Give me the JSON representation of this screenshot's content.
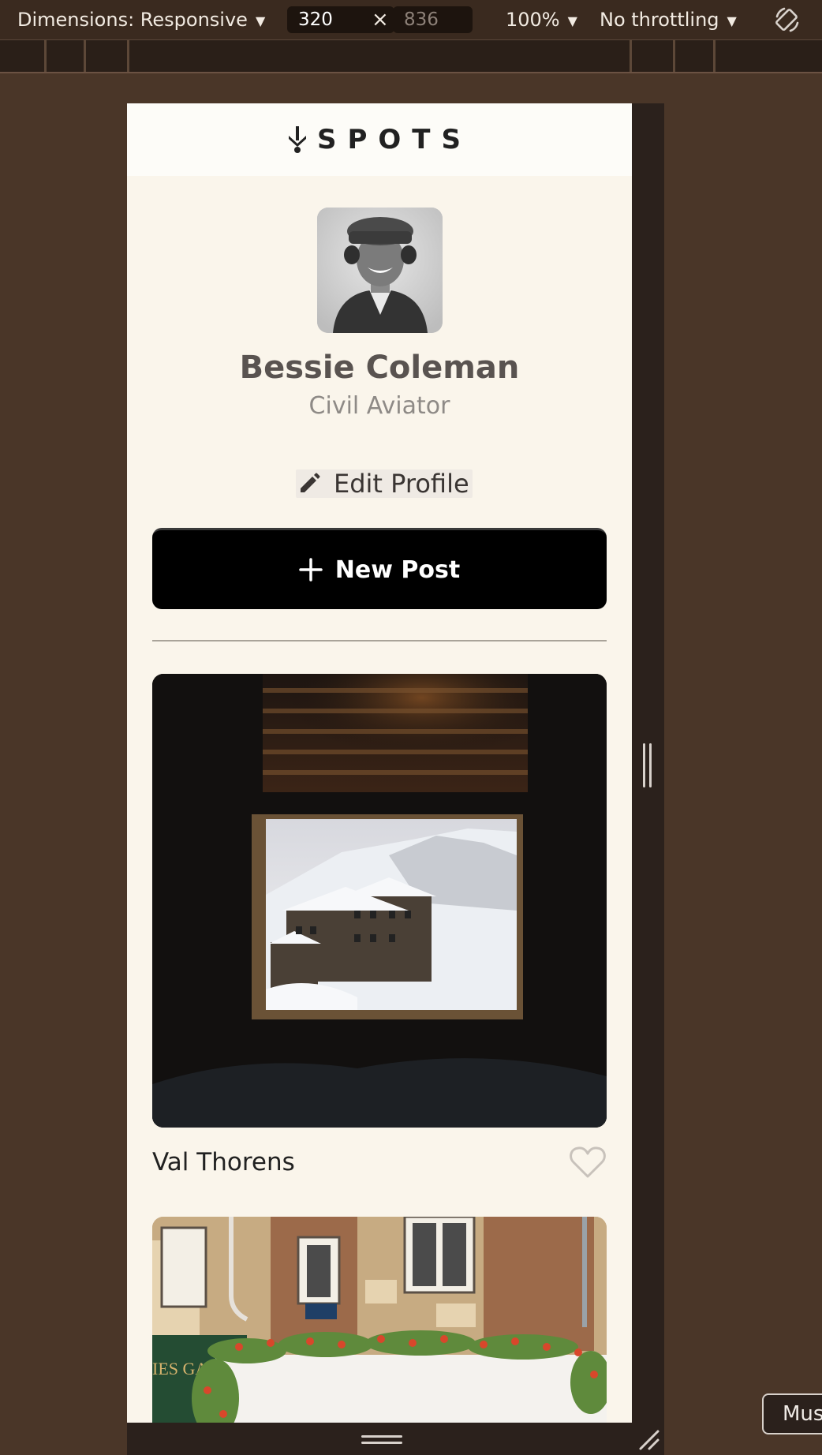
{
  "devtools": {
    "dimensions_label": "Dimensions: Responsive",
    "width_value": "320",
    "times_symbol": "×",
    "height_placeholder": "836",
    "zoom_label": "100%",
    "throttling_label": "No throttling"
  },
  "header": {
    "logo_text": "SPOTS"
  },
  "profile": {
    "name": "Bessie Coleman",
    "description": "Civil Aviator",
    "edit_label": "Edit Profile",
    "new_post_label": "New Post"
  },
  "cards": [
    {
      "title": "Val Thorens",
      "liked": false
    },
    {
      "title": "",
      "liked": false
    }
  ],
  "colors": {
    "page_bg": "#faf5eb",
    "header_bg": "#fdfcf8",
    "primary_button": "#000000",
    "devtools_bg": "#3a2a1f",
    "outer_bg": "#4a3628"
  },
  "tooltip": {
    "text": "Mus"
  }
}
